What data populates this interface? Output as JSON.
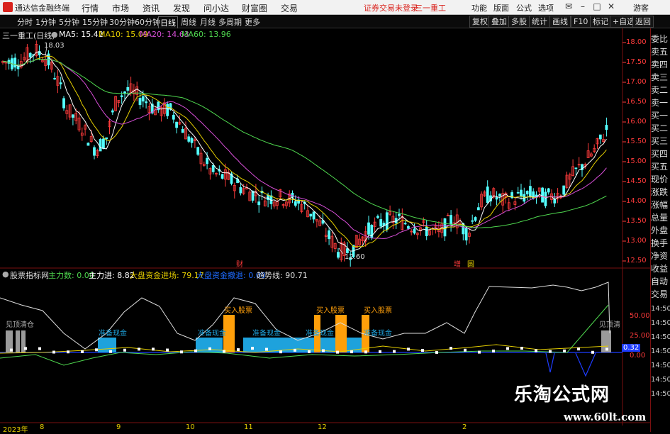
{
  "app": {
    "name": "通达信金融终端",
    "menu": [
      "行情",
      "市场",
      "资讯",
      "发现",
      "问小达",
      "财富圈",
      "交易"
    ],
    "login_notice": "证券交易未登录",
    "stock_title": "三一重工",
    "right_menu": [
      "功能",
      "版面",
      "公式",
      "选项",
      "游客"
    ]
  },
  "toolbar": {
    "periods": [
      "分时",
      "1分钟",
      "5分钟",
      "15分钟",
      "30分钟",
      "60分钟",
      "日线",
      "周线",
      "月线",
      "多周期",
      "更多"
    ],
    "active_period": "日线",
    "buttons": [
      "复权",
      "叠加",
      "多股",
      "统计",
      "画线",
      "F10",
      "标记",
      "+自选",
      "返回"
    ]
  },
  "main": {
    "stock": "三一重工(日线)",
    "ma5": "MA5: 15.42",
    "ma10": "MA10: 15.09",
    "ma20": "MA20: 14.63",
    "ma60": "MA60: 13.96",
    "high_label": "18.03",
    "low_label": "12.60",
    "markers": [
      "财",
      "增",
      "圆"
    ],
    "price_axis": [
      "18.00",
      "17.50",
      "17.00",
      "16.50",
      "16.00",
      "15.50",
      "15.00",
      "14.50",
      "14.00",
      "13.50",
      "13.00",
      "12.50"
    ]
  },
  "sub": {
    "indicator_name": "股票指标网",
    "zhulishu": "主力数: 0.00",
    "zhulijin": "主力进: 8.82",
    "dapan": "大盘资金进场: 79.17",
    "danchuan": "大盘资金撤退: 0.00",
    "qushi": "趋势线: 90.71",
    "labels": {
      "clear": "见顶清仓",
      "prepare": "准备现金",
      "buy": "买入股票"
    },
    "axis": [
      "50.00",
      "25.00",
      "0.00"
    ],
    "last_value": "0.32"
  },
  "sidebar": [
    "委比",
    "卖五",
    "卖四",
    "卖三",
    "卖二",
    "卖一",
    "买一",
    "买二",
    "买三",
    "买四",
    "买五",
    "现价",
    "涨跌",
    "涨幅",
    "总量",
    "外盘",
    "换手",
    "净资",
    "收益",
    "自动",
    "交易"
  ],
  "sidebar_right_axis": [
    "14:50",
    "14:50",
    "14:50",
    "14:50",
    "14:50",
    "14:50",
    "14:50"
  ],
  "dates": [
    "2023年",
    "8",
    "9",
    "10",
    "11",
    "12",
    "2"
  ],
  "watermark": {
    "title": "乐淘公式网",
    "url": "www.60lt.com"
  },
  "colors": {
    "up": "#ff3b3b",
    "down": "#54ffff",
    "ma5": "#ffffff",
    "ma10": "#e6cf00",
    "ma20": "#d84fd8",
    "ma60": "#4fd84f",
    "prepare": "#1ea2dc",
    "buy": "#ff9f0a",
    "clear": "#9a9a9a"
  }
}
